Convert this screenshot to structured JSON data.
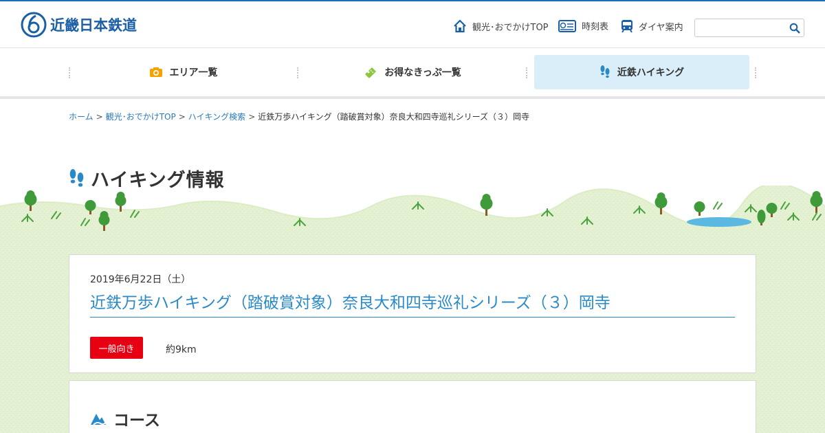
{
  "header": {
    "logo_text": "近畿日本鉄道",
    "links": [
      {
        "label": "観光･おでかけTOP",
        "icon": "house-icon"
      },
      {
        "label": "時刻表",
        "icon": "timetable-icon"
      },
      {
        "label": "ダイヤ案内",
        "icon": "train-icon"
      }
    ],
    "search": {
      "placeholder": "",
      "value": "",
      "icon": "magnifier-icon"
    },
    "accent_color": "#1a6fb5"
  },
  "global_nav": {
    "items": [
      {
        "label": "エリア一覧",
        "icon": "camera-icon",
        "underline_color": "#f5a100"
      },
      {
        "label": "お得なきっぷ一覧",
        "icon": "ticket-icon",
        "underline_color": "#8cc63f"
      },
      {
        "label": "近鉄ハイキング",
        "icon": "footprints-icon",
        "underline_color": "#2a8ac8",
        "active": true
      }
    ]
  },
  "breadcrumb": {
    "items": [
      "ホーム",
      "観光･おでかけTOP",
      "ハイキング検索"
    ],
    "current": "近鉄万歩ハイキング（踏破賞対象）奈良大和四寺巡礼シリーズ（３）岡寺",
    "separator": ">"
  },
  "page_title": "ハイキング情報",
  "event": {
    "date": "2019年6月22日（土）",
    "title": "近鉄万歩ハイキング（踏破賞対象）奈良大和四寺巡礼シリーズ（３）岡寺",
    "level_badge": "一般向き",
    "level_color": "#e60012",
    "distance": "約9km"
  },
  "course_section": {
    "heading": "コース",
    "icon": "mountain-icon"
  }
}
